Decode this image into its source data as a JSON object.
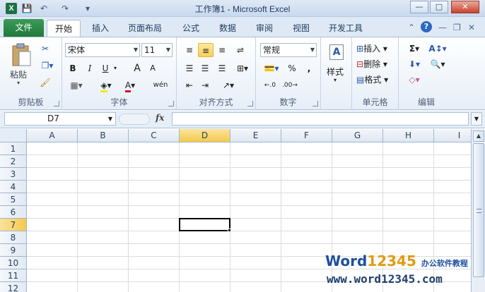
{
  "window": {
    "title": "工作簿1 - Microsoft Excel",
    "app_icon_letter": "X",
    "qat": [
      "💾",
      "↶",
      "↷",
      "▾"
    ],
    "min": "—",
    "max": "□",
    "close": "✕"
  },
  "tabs": {
    "file": "文件",
    "items": [
      "开始",
      "插入",
      "页面布局",
      "公式",
      "数据",
      "审阅",
      "视图",
      "开发工具"
    ],
    "active": "开始"
  },
  "ribbon": {
    "clipboard": {
      "label": "剪贴板",
      "paste": "粘贴"
    },
    "font": {
      "label": "字体",
      "name": "宋体",
      "size": "11",
      "bold": "B",
      "italic": "I",
      "underline": "U",
      "grow": "A",
      "shrink": "A",
      "wen": "wén"
    },
    "align": {
      "label": "对齐方式"
    },
    "number": {
      "label": "数字",
      "format": "常规",
      "percent": "%",
      "comma": ","
    },
    "styles": {
      "label": "样式"
    },
    "cells": {
      "label": "单元格",
      "insert": "插入",
      "delete": "删除",
      "format": "格式"
    },
    "editing": {
      "label": "编辑",
      "sum": "Σ"
    }
  },
  "formula_bar": {
    "name_box": "D7",
    "fx": "fx",
    "value": ""
  },
  "grid": {
    "columns": [
      "A",
      "B",
      "C",
      "D",
      "E",
      "F",
      "G",
      "H",
      "I"
    ],
    "rows": [
      "1",
      "2",
      "3",
      "4",
      "5",
      "6",
      "7",
      "8",
      "9",
      "10",
      "11",
      "12"
    ],
    "active_col": "D",
    "active_row": "7"
  },
  "watermark": {
    "brand_w": "W",
    "brand_ord": "ord",
    "brand_num": "12345",
    "brand_sub": "办公软件教程",
    "url": "www.word12345.com"
  }
}
